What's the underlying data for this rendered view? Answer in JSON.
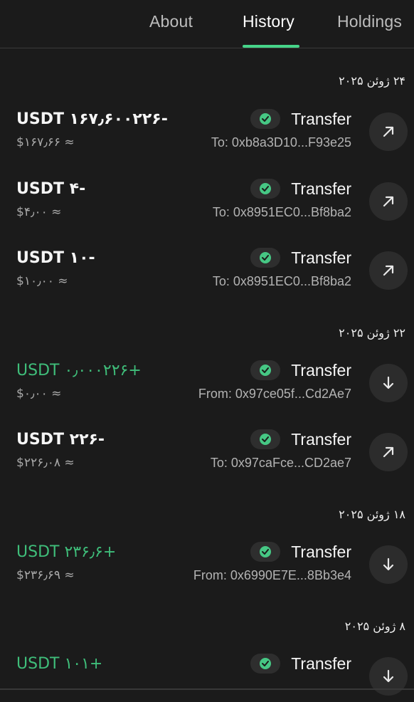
{
  "tabs": {
    "about": "About",
    "history": "History",
    "holdings": "Holdings"
  },
  "colors": {
    "accent": "#46d489",
    "incoming": "#3fbe7a",
    "background": "#1b1b1b"
  },
  "groups": [
    {
      "date": "۲۴ ژوئن ۲۰۲۵",
      "items": [
        {
          "amount": "USDT ۱۶۷٫۶۰۰۲۲۶-",
          "fiat": "$۱۶۷٫۶۶ ≈",
          "type": "Transfer",
          "party": "To: 0xb8a3D10...F93e25",
          "direction": "out",
          "status": "completed",
          "icon": "arrow-up-right-icon"
        },
        {
          "amount": "USDT ۴-",
          "fiat": "$۴٫۰۰ ≈",
          "type": "Transfer",
          "party": "To: 0x8951EC0...Bf8ba2",
          "direction": "out",
          "status": "completed",
          "icon": "arrow-up-right-icon"
        },
        {
          "amount": "USDT ۱۰-",
          "fiat": "$۱۰٫۰۰ ≈",
          "type": "Transfer",
          "party": "To: 0x8951EC0...Bf8ba2",
          "direction": "out",
          "status": "completed",
          "icon": "arrow-up-right-icon"
        }
      ]
    },
    {
      "date": "۲۲ ژوئن ۲۰۲۵",
      "items": [
        {
          "amount": "USDT ۰٫۰۰۰۲۲۶+",
          "fiat": "$۰٫۰۰ ≈",
          "type": "Transfer",
          "party": "From: 0x97ce05f...Cd2Ae7",
          "direction": "in",
          "status": "completed",
          "icon": "arrow-down-icon"
        },
        {
          "amount": "USDT ۲۲۶-",
          "fiat": "$۲۲۶٫۰۸ ≈",
          "type": "Transfer",
          "party": "To: 0x97caFce...CD2ae7",
          "direction": "out",
          "status": "completed",
          "icon": "arrow-up-right-icon"
        }
      ]
    },
    {
      "date": "۱۸ ژوئن ۲۰۲۵",
      "items": [
        {
          "amount": "USDT ۲۳۶٫۶+",
          "fiat": "$۲۳۶٫۶۹ ≈",
          "type": "Transfer",
          "party": "From: 0x6990E7E...8Bb3e4",
          "direction": "in",
          "status": "completed",
          "icon": "arrow-down-icon"
        }
      ]
    },
    {
      "date": "۸ ژوئن ۲۰۲۵",
      "items": [
        {
          "amount": "USDT ۱۰۱+",
          "fiat": "",
          "type": "Transfer",
          "party": "",
          "direction": "in",
          "status": "completed",
          "icon": "arrow-down-icon"
        }
      ]
    }
  ]
}
